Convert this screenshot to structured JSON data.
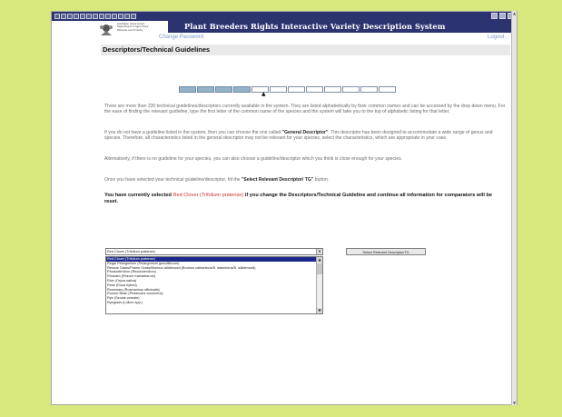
{
  "header": {
    "title": "Plant Breeders Rights Interactive Variety Description System",
    "agency_lines": [
      "Australian Government",
      "Department of Agriculture,",
      "Fisheries and Forestry"
    ]
  },
  "nav": {
    "change_password": "Change Password",
    "logout": "Logout"
  },
  "section": {
    "title": "Descriptors/Technical Guidelines"
  },
  "progress": {
    "total_steps": 12,
    "completed_steps": 4,
    "current_step": 5
  },
  "paragraphs": {
    "p1": "There are more than 230 technical guidelines/descriptors currently available in the system. They are listed alphabetically by their common names and can be accessed by the drop down menu. For the ease of finding the relevant guideline, type the first letter of the common name of the species and the system will take you to the top of alphabetic listing for that letter.",
    "p2_a": "If you do not have a guideline listed in the system, then you can choose the one called ",
    "p2_bold": "\"General Descriptor\"",
    "p2_b": ". This descriptor has been designed to accommodate a wide range of genus and species. Therefore, all characteristics listed in the general descriptor may not be relevant for your species, select the characteristics, which are appropriate in your case.",
    "p3": "Alternatively, if there is no guideline for your species, you can also choose a guideline/descriptor which you think is close enough for your species.",
    "p4_a": "Once you have selected your technical guideline/descriptor, hit the ",
    "p4_bold": "\"Select Relevant Descriptor/ TG\"",
    "p4_b": " button."
  },
  "notice": {
    "prefix": "You have currently selected ",
    "selected": "Red Clover (Trifolium pratense)",
    "suffix": " if you change the Descriptors/Technical Guideline and continue all information for comparators will be reset."
  },
  "descriptor_select": {
    "value": "Red Clover (Trifolium pratense)",
    "options": [
      "Red Clover (Trifolium pratense)",
      "Regal Pelargonium (Pelargonium grandiflorum)",
      "Rescue Grass/Prairie Grass/Bromus willdenowii (Bromus catharticus/B. stamineus/B. willdenowii)",
      "Rhododendron (Rhododendron)",
      "Rhubarb (Rheum rhabarbarum)",
      "Rice (Oryza sativa)",
      "Rose (Rosa hybrid)",
      "Rosemary (Rosmarinus officinalis)",
      "Runner Bean (Phaseolus coccineus)",
      "Rye (Secale cereale)",
      "Ryegrass (Lolium spp.)"
    ],
    "active_index": 0
  },
  "action_button": {
    "label": "Select Relevant Descriptor/TG"
  },
  "colors": {
    "background": "#d9e87d",
    "header_bar": "#2c3470",
    "link": "#7a96c8",
    "selected_highlight": "#d03030",
    "progress_done": "#94b3c8"
  }
}
